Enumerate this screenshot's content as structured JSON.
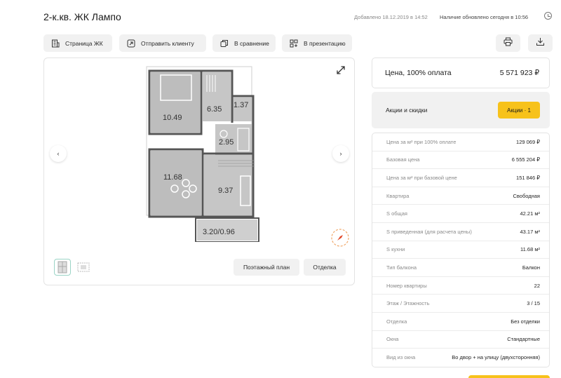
{
  "header": {
    "title": "2-к.кв. ЖК Лампо",
    "added": "Добавлено 18.12.2019 в 14:52",
    "updated": "Наличие обновлено сегодня в 10:56"
  },
  "toolbar": {
    "complex_page": "Страница ЖК",
    "send_client": "Отправить клиенту",
    "compare": "В сравнение",
    "presentation": "В презентацию"
  },
  "plan": {
    "rooms": [
      "10.49",
      "6.35",
      "1.37",
      "2.95",
      "11.68",
      "9.37",
      "3.20/0.96"
    ],
    "floor_plan_button": "Поэтажный план",
    "finish_button": "Отделка"
  },
  "price": {
    "label": "Цена, 100% оплата",
    "value": "5 571 923 ₽"
  },
  "promo": {
    "label": "Акции и скидки",
    "badge": "Акции · 1",
    "badge_color": "#f7c21b"
  },
  "specs": [
    {
      "key": "Цена за м² при 100% оплате",
      "value": "129 069 ₽"
    },
    {
      "key": "Базовая цена",
      "value": "6 555 204 ₽"
    },
    {
      "key": "Цена за м² при базовой цене",
      "value": "151 846 ₽"
    },
    {
      "key": "Квартира",
      "value": "Свободная"
    },
    {
      "key": "S общая",
      "value": "42.21 м²"
    },
    {
      "key": "S приведенная (для расчета цены)",
      "value": "43.17 м²"
    },
    {
      "key": "S кухни",
      "value": "11.68 м²"
    },
    {
      "key": "Тип балкона",
      "value": "Балкон"
    },
    {
      "key": "Номер квартиры",
      "value": "22"
    },
    {
      "key": "Этаж / Этажность",
      "value": "3 / 15"
    },
    {
      "key": "Отделка",
      "value": "Без отделки"
    },
    {
      "key": "Окна",
      "value": "Стандартные"
    },
    {
      "key": "Вид из окна",
      "value": "Во двор + на улицу (двухсторонняя)"
    }
  ],
  "icons": {
    "building": "building-icon",
    "share": "share-arrow-icon",
    "compare": "copy-icon",
    "presentation": "grid-icon",
    "print": "printer-icon",
    "download": "download-icon",
    "expand": "expand-icon",
    "clock": "clock-icon"
  }
}
